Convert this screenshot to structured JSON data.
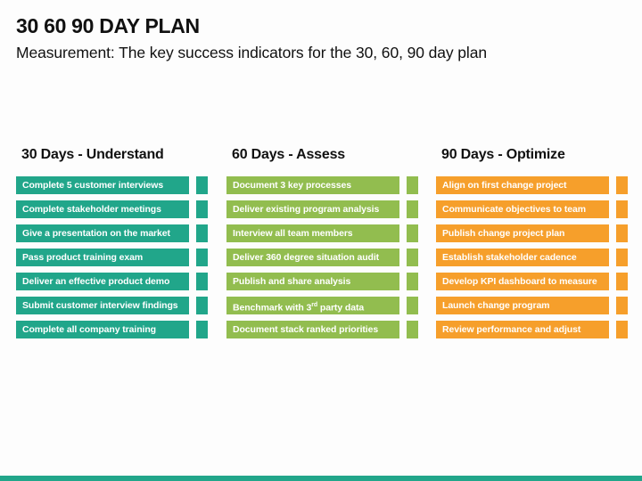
{
  "title": "30 60 90 DAY PLAN",
  "subtitle": "Measurement: The key success indicators for the 30, 60, 90 day plan",
  "colors": {
    "teal": "#21a68a",
    "green": "#92bd4f",
    "orange": "#f69f2b",
    "bottom_bar": "#21a68a"
  },
  "columns": [
    {
      "heading": "30 Days - Understand",
      "color": "#21a68a",
      "items": [
        "Complete 5 customer interviews",
        "Complete stakeholder meetings",
        "Give a presentation on the market",
        "Pass product training exam",
        "Deliver an effective product demo",
        "Submit customer interview findings",
        "Complete all company training"
      ]
    },
    {
      "heading": "60 Days - Assess",
      "color": "#92bd4f",
      "items": [
        "Document 3 key processes",
        "Deliver existing program analysis",
        "Interview all team members",
        "Deliver 360 degree situation audit",
        "Publish and share analysis",
        "Benchmark with 3rd party data",
        "Document stack ranked priorities"
      ]
    },
    {
      "heading": "90 Days - Optimize",
      "color": "#f69f2b",
      "items": [
        "Align on first change project",
        "Communicate objectives to team",
        "Publish change project plan",
        "Establish stakeholder cadence",
        "Develop KPI dashboard to measure",
        "Launch change program",
        "Review performance and adjust"
      ]
    }
  ]
}
